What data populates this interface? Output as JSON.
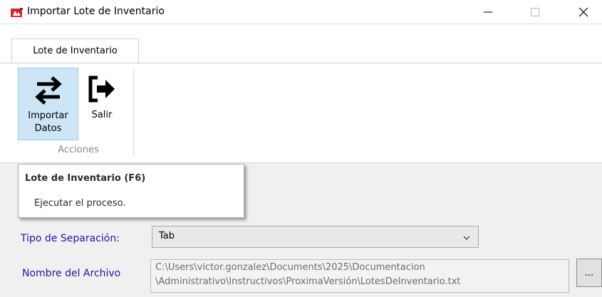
{
  "window": {
    "title": "Importar Lote de Inventario",
    "icon": "app-icon",
    "controls": {
      "minimize_icon": "minimize-icon",
      "maximize_icon": "maximize-icon",
      "close_icon": "close-icon"
    }
  },
  "ribbon": {
    "tab_label": "Lote de Inventario",
    "buttons": [
      {
        "label": "Importar\nDatos",
        "icon": "swap-arrows-icon",
        "selected": true
      },
      {
        "label": "Salir",
        "icon": "exit-icon",
        "selected": false
      }
    ],
    "group_label": "Acciones"
  },
  "tooltip": {
    "title": "Lote de Inventario (F6)",
    "description": "Ejecutar el proceso."
  },
  "form": {
    "separation_label": "Tipo de Separación:",
    "separation_value": "Tab",
    "file_label": "Nombre del Archivo",
    "file_path_line1": "C:\\Users\\victor.gonzalez\\Documents\\2025\\Documentacion",
    "file_path_line2": "\\Administrativo\\Instructivos\\ProximaVersión\\LotesDeInventario.txt",
    "browse_label": "..."
  },
  "colors": {
    "label_blue": "#1a1aa6",
    "selected_button_bg": "#cde6f7",
    "selected_button_border": "#99c9ef"
  }
}
